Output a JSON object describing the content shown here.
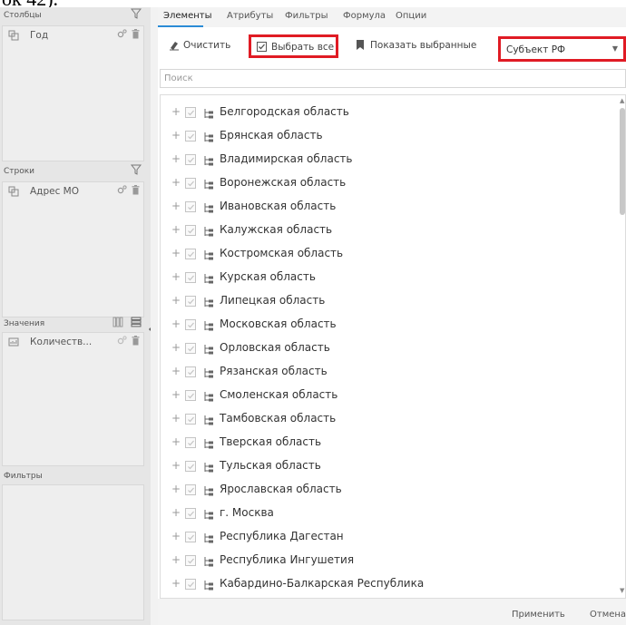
{
  "top_fragment": "ок 42).",
  "left_panel": {
    "columns": {
      "title": "Столбцы",
      "fields": [
        {
          "label": "Год"
        }
      ]
    },
    "rows": {
      "title": "Строки",
      "fields": [
        {
          "label": "Адрес МО"
        }
      ]
    },
    "values": {
      "title": "Значения",
      "fields": [
        {
          "label": "Количеств..."
        }
      ]
    },
    "filters": {
      "title": "Фильтры"
    }
  },
  "tabs": [
    {
      "label": "Элементы",
      "active": true
    },
    {
      "label": "Атрибуты"
    },
    {
      "label": "Фильтры"
    },
    {
      "label": "Формула"
    },
    {
      "label": "Опции"
    }
  ],
  "toolbar": {
    "clear_label": "Очистить",
    "select_all_label": "Выбрать все",
    "show_selected_label": "Показать выбранные",
    "dimension_select": "Субъект РФ"
  },
  "search": {
    "placeholder": "Поиск"
  },
  "list": {
    "items": [
      "Белгородская область",
      "Брянская область",
      "Владимирская область",
      "Воронежская область",
      "Ивановская область",
      "Калужская область",
      "Костромская область",
      "Курская область",
      "Липецкая область",
      "Московская область",
      "Орловская область",
      "Рязанская область",
      "Смоленская область",
      "Тамбовская область",
      "Тверская область",
      "Тульская область",
      "Ярославская область",
      "г. Москва",
      "Республика Дагестан",
      "Республика Ингушетия",
      "Кабардино-Балкарская Республика"
    ]
  },
  "footer": {
    "apply_label": "Применить",
    "cancel_label": "Отмена"
  },
  "colors": {
    "accent": "#2b8bd6",
    "highlight": "#e01b24",
    "panel_bg": "#e6e6e6"
  }
}
